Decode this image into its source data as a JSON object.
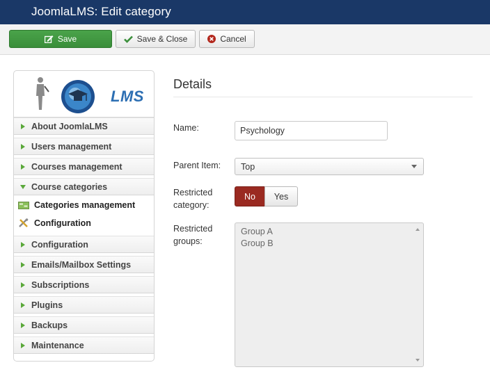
{
  "header": {
    "title": "JoomlaLMS: Edit category"
  },
  "toolbar": {
    "save_label": "Save",
    "save_close_label": "Save & Close",
    "cancel_label": "Cancel"
  },
  "sidebar": {
    "logo_text": "LMS",
    "items": [
      {
        "label": "About JoomlaLMS"
      },
      {
        "label": "Users management"
      },
      {
        "label": "Courses management"
      },
      {
        "label": "Course categories",
        "expanded": true,
        "children": [
          {
            "label": "Categories management",
            "icon": "categories-icon"
          },
          {
            "label": "Configuration",
            "icon": "tools-icon"
          }
        ]
      },
      {
        "label": "Configuration"
      },
      {
        "label": "Emails/Mailbox Settings"
      },
      {
        "label": "Subscriptions"
      },
      {
        "label": "Plugins"
      },
      {
        "label": "Backups"
      },
      {
        "label": "Maintenance"
      }
    ]
  },
  "form": {
    "section_title": "Details",
    "name_label": "Name:",
    "name_value": "Psychology",
    "parent_label": "Parent Item:",
    "parent_value": "Top",
    "restricted_label_1": "Restricted",
    "restricted_label_2": "category:",
    "restricted_no": "No",
    "restricted_yes": "Yes",
    "restricted_value": "No",
    "groups_label_1": "Restricted",
    "groups_label_2": "groups:",
    "groups_options": [
      "Group A",
      "Group B"
    ]
  },
  "colors": {
    "header_bg": "#1a3867",
    "save_green": "#3a8e3a",
    "toggle_no_red": "#9a2a21",
    "nav_arrow_green": "#5aa83a"
  }
}
